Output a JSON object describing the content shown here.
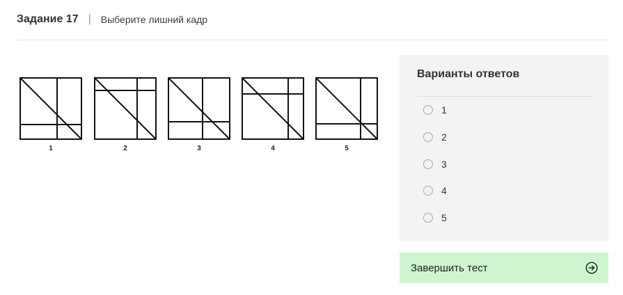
{
  "header": {
    "task_title": "Задание 17",
    "separator": "|",
    "instruction": "Выберите лишний кадр"
  },
  "frames": [
    {
      "label": "1"
    },
    {
      "label": "2"
    },
    {
      "label": "3"
    },
    {
      "label": "4"
    },
    {
      "label": "5"
    }
  ],
  "answers": {
    "title": "Варианты ответов",
    "options": [
      "1",
      "2",
      "3",
      "4",
      "5"
    ],
    "selected": null
  },
  "finish": {
    "label": "Завершить тест",
    "icon": "arrow-right-circle-icon"
  },
  "colors": {
    "panel_bg": "#f3f3f3",
    "finish_bg": "#cff5cf"
  }
}
